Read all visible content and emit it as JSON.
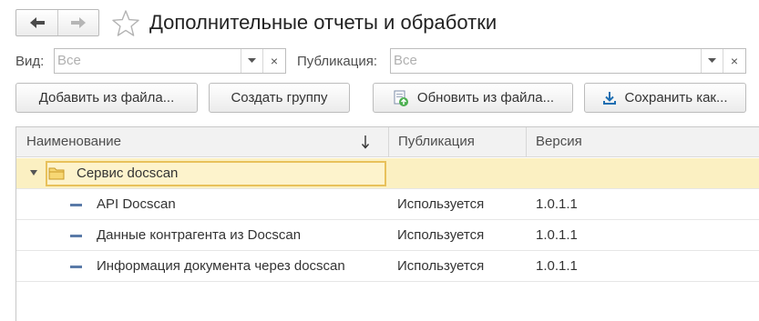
{
  "window": {
    "title": "Дополнительные отчеты и обработки",
    "nav_back_icon": "arrow-left-icon",
    "nav_forward_icon": "arrow-right-icon",
    "favorite_icon": "star-icon"
  },
  "filters": {
    "kind": {
      "label": "Вид:",
      "value": "Все"
    },
    "publication": {
      "label": "Публикация:",
      "value": "Все"
    },
    "clear_glyph": "×"
  },
  "toolbar": {
    "add_from_file": "Добавить из файла...",
    "create_group": "Создать группу",
    "update_from_file": "Обновить из файла...",
    "save_as": "Сохранить как..."
  },
  "table": {
    "columns": {
      "name": "Наименование",
      "publication": "Публикация",
      "version": "Версия"
    },
    "sort_icon": "sort-descending-icon",
    "group": {
      "name": "Сервис docscan",
      "icon": "folder-icon",
      "expanded": true
    },
    "rows": [
      {
        "name": "API Docscan",
        "publication": "Используется",
        "version": "1.0.1.1"
      },
      {
        "name": "Данные контрагента из Docscan",
        "publication": "Используется",
        "version": "1.0.1.1"
      },
      {
        "name": "Информация документа через docscan",
        "publication": "Используется",
        "version": "1.0.1.1"
      }
    ]
  },
  "colors": {
    "group_row_background": "#fbf0c2",
    "selection_border": "#e8c15b",
    "folder": "#f0c650",
    "item_icon": "#5a7aa8"
  }
}
